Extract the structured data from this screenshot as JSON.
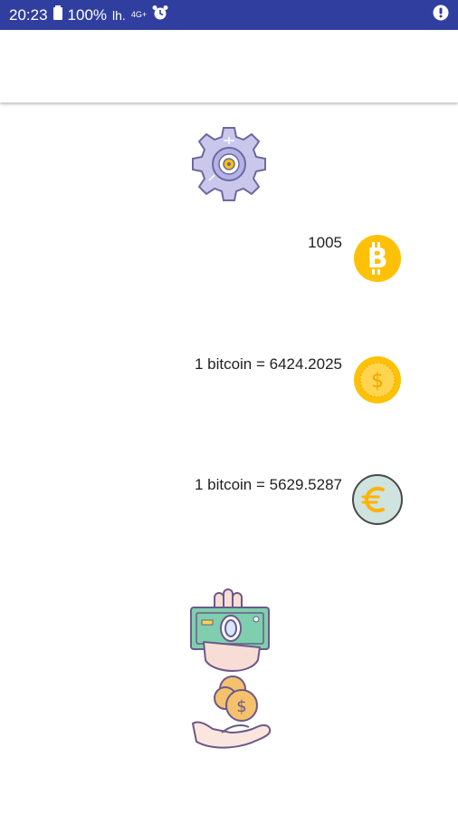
{
  "status_bar": {
    "time": "20:23",
    "battery_percent": "100%",
    "signal_label": "lh.",
    "network_label": "4G+",
    "icons": [
      "battery-icon",
      "signal-icon",
      "alarm-icon",
      "info-icon"
    ]
  },
  "settings": {
    "icon": "gear-icon"
  },
  "rows": [
    {
      "text": "1005",
      "icon": "bitcoin-icon"
    },
    {
      "text": "1 bitcoin = 6424.2025",
      "icon": "dollar-coin-icon"
    },
    {
      "text": "1 bitcoin = 5629.5287",
      "icon": "euro-coin-icon"
    }
  ],
  "illustration": {
    "icon": "money-exchange-icon"
  },
  "colors": {
    "status_bar": "#303f9f",
    "coin_gold": "#ffc107",
    "gear_lavender": "#c9c8ec",
    "euro_coin_bg": "#cfe3df"
  }
}
